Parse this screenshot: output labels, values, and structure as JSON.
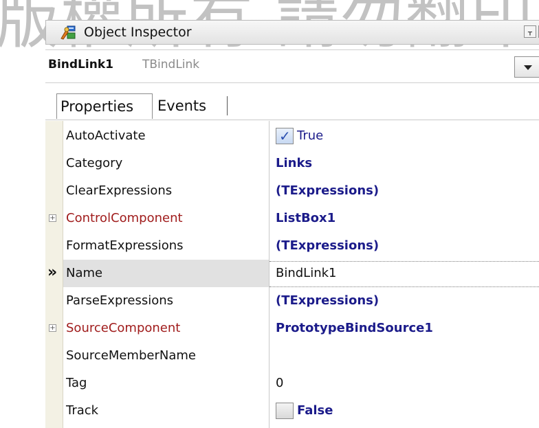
{
  "watermark": "版權所有 請勿翻印",
  "window": {
    "title": "Object Inspector",
    "pin_glyph": "ᚁ",
    "close_glyph": "☒"
  },
  "selector": {
    "component_name": "BindLink1",
    "component_type": "TBindLink"
  },
  "tabs": [
    {
      "label": "Properties",
      "active": true
    },
    {
      "label": "Events",
      "active": false
    }
  ],
  "properties": [
    {
      "name": "AutoActivate",
      "value": "True",
      "kind": "checkbox",
      "checked": true
    },
    {
      "name": "Category",
      "value": "Links",
      "kind": "bold"
    },
    {
      "name": "ClearExpressions",
      "value": "(TExpressions)",
      "kind": "bold"
    },
    {
      "name": "ControlComponent",
      "value": "ListBox1",
      "kind": "bold",
      "expandable": true,
      "reference": true
    },
    {
      "name": "FormatExpressions",
      "value": "(TExpressions)",
      "kind": "bold"
    },
    {
      "name": "Name",
      "value": "BindLink1",
      "kind": "plain",
      "selected": true
    },
    {
      "name": "ParseExpressions",
      "value": "(TExpressions)",
      "kind": "bold"
    },
    {
      "name": "SourceComponent",
      "value": "PrototypeBindSource1",
      "kind": "bold",
      "expandable": true,
      "reference": true
    },
    {
      "name": "SourceMemberName",
      "value": "",
      "kind": "plain"
    },
    {
      "name": "Tag",
      "value": "0",
      "kind": "plain"
    },
    {
      "name": "Track",
      "value": "False",
      "kind": "checkbox",
      "checked": false
    }
  ],
  "colors": {
    "reference_name": "#a01c1c",
    "value_blue": "#1b1b8a",
    "gutter": "#f3f1e4"
  }
}
